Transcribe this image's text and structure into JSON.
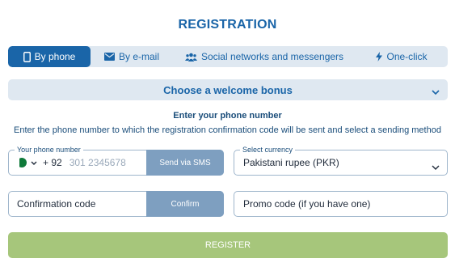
{
  "title": "REGISTRATION",
  "tabs": [
    {
      "label": "By phone",
      "icon": "phone-icon",
      "active": true
    },
    {
      "label": "By e-mail",
      "icon": "mail-icon",
      "active": false
    },
    {
      "label": "Social networks and messengers",
      "icon": "users-icon",
      "active": false
    },
    {
      "label": "One-click",
      "icon": "lightning-icon",
      "active": false
    }
  ],
  "bonus": {
    "label": "Choose a welcome bonus"
  },
  "subheading": "Enter your phone number",
  "description": "Enter the phone number to which the registration confirmation code will be sent and select a sending method",
  "phone": {
    "legend": "Your phone number",
    "country_code": "+ 92",
    "placeholder": "301 2345678",
    "flag": "pakistan-flag-icon",
    "send_label": "Send via SMS"
  },
  "currency": {
    "legend": "Select currency",
    "value": "Pakistani rupee (PKR)"
  },
  "confirmation": {
    "placeholder": "Confirmation code",
    "button_label": "Confirm"
  },
  "promo": {
    "placeholder": "Promo code (if you have one)"
  },
  "register_label": "REGISTER",
  "colors": {
    "accent": "#1a65a8",
    "tab_bg": "#dfe8f1",
    "disabled_button": "#7e9fc0",
    "register_bg": "#a6c67b"
  }
}
